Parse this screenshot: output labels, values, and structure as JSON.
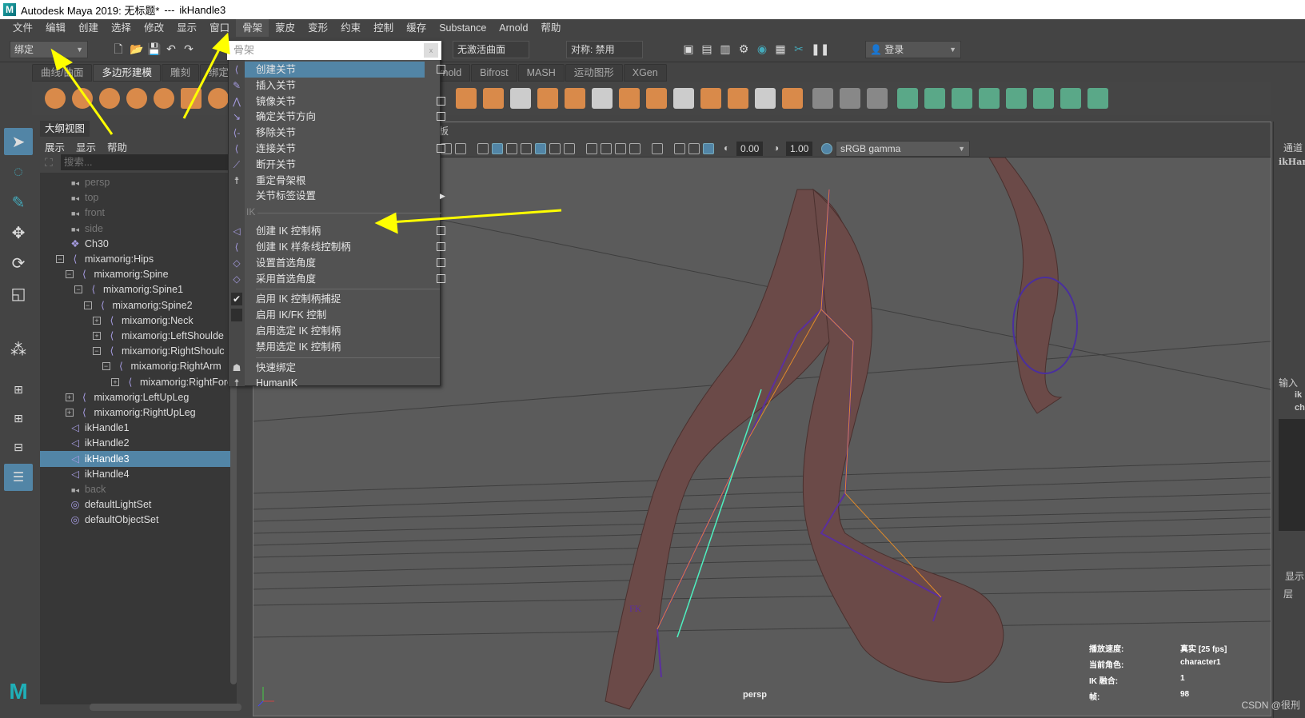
{
  "title": {
    "app": "Autodesk Maya 2019: 无标题*",
    "sep": "---",
    "object": "ikHandle3",
    "logo_letter": "M"
  },
  "menubar": [
    "文件",
    "编辑",
    "创建",
    "选择",
    "修改",
    "显示",
    "窗口",
    "骨架",
    "蒙皮",
    "变形",
    "约束",
    "控制",
    "缓存",
    "Substance",
    "Arnold",
    "帮助"
  ],
  "status": {
    "mode": "绑定",
    "menu_search_placeholder": "骨架",
    "curve": "无激活曲面",
    "symmetry": "对称: 禁用",
    "login": "登录"
  },
  "shelf_tabs": [
    "曲线/曲面",
    "多边形建模",
    "雕刻",
    "绑定",
    "Arnold",
    "Bifrost",
    "MASH",
    "运动图形",
    "XGen"
  ],
  "shelf_active": "多边形建模",
  "outliner": {
    "tab": "大纲视图",
    "menu": [
      "展示",
      "显示",
      "帮助"
    ],
    "search_placeholder": "搜索...",
    "items": [
      {
        "label": "persp",
        "icon": "camera-icon",
        "depth": 0,
        "dim": true
      },
      {
        "label": "top",
        "icon": "camera-icon",
        "depth": 0,
        "dim": true
      },
      {
        "label": "front",
        "icon": "camera-icon",
        "depth": 0,
        "dim": true
      },
      {
        "label": "side",
        "icon": "camera-icon",
        "depth": 0,
        "dim": true
      },
      {
        "label": "Ch30",
        "icon": "mesh-group-icon",
        "depth": 0
      },
      {
        "label": "mixamorig:Hips",
        "icon": "joint-icon",
        "depth": 0,
        "exp": "-"
      },
      {
        "label": "mixamorig:Spine",
        "icon": "joint-icon",
        "depth": 1,
        "exp": "-"
      },
      {
        "label": "mixamorig:Spine1",
        "icon": "joint-icon",
        "depth": 2,
        "exp": "-"
      },
      {
        "label": "mixamorig:Spine2",
        "icon": "joint-icon",
        "depth": 3,
        "exp": "-"
      },
      {
        "label": "mixamorig:Neck",
        "icon": "joint-icon",
        "depth": 4,
        "exp": "+"
      },
      {
        "label": "mixamorig:LeftShoulde",
        "icon": "joint-icon",
        "depth": 4,
        "exp": "+"
      },
      {
        "label": "mixamorig:RightShoulc",
        "icon": "joint-icon",
        "depth": 4,
        "exp": "-"
      },
      {
        "label": "mixamorig:RightArm",
        "icon": "joint-icon",
        "depth": 5,
        "exp": "-"
      },
      {
        "label": "mixamorig:RightFore",
        "icon": "joint-icon",
        "depth": 6,
        "exp": "+"
      },
      {
        "label": "mixamorig:LeftUpLeg",
        "icon": "joint-icon",
        "depth": 1,
        "exp": "+"
      },
      {
        "label": "mixamorig:RightUpLeg",
        "icon": "joint-icon",
        "depth": 1,
        "exp": "+"
      },
      {
        "label": "ikHandle1",
        "icon": "ik-handle-icon",
        "depth": 0
      },
      {
        "label": "ikHandle2",
        "icon": "ik-handle-icon",
        "depth": 0
      },
      {
        "label": "ikHandle3",
        "icon": "ik-handle-icon",
        "depth": 0,
        "selected": true
      },
      {
        "label": "ikHandle4",
        "icon": "ik-handle-icon",
        "depth": 0
      },
      {
        "label": "back",
        "icon": "camera-icon",
        "depth": 0,
        "dim": true
      },
      {
        "label": "defaultLightSet",
        "icon": "set-icon",
        "depth": 0
      },
      {
        "label": "defaultObjectSet",
        "icon": "set-icon",
        "depth": 0
      }
    ]
  },
  "skeleton_menu": {
    "items": [
      {
        "label": "创建关节",
        "icon": "create-joint-icon",
        "option": true,
        "highlight": true
      },
      {
        "label": "插入关节",
        "icon": "insert-joint-icon"
      },
      {
        "label": "镜像关节",
        "icon": "mirror-joint-icon",
        "option": true
      },
      {
        "label": "确定关节方向",
        "icon": "orient-joint-icon",
        "option": true
      },
      {
        "label": "移除关节",
        "icon": "remove-joint-icon"
      },
      {
        "label": "连接关节",
        "icon": "connect-joint-icon",
        "option": true
      },
      {
        "label": "断开关节",
        "icon": "disconnect-joint-icon"
      },
      {
        "label": "重定骨架根",
        "icon": "reroot-skeleton-icon"
      },
      {
        "label": "关节标签设置",
        "icon": "",
        "submenu": true
      }
    ],
    "ik_section": "IK",
    "ik_items": [
      {
        "label": "创建 IK 控制柄",
        "icon": "ik-handle-icon",
        "option": true
      },
      {
        "label": "创建 IK 样条线控制柄",
        "icon": "ik-spline-icon",
        "option": true
      },
      {
        "label": "设置首选角度",
        "icon": "set-preferred-angle-icon",
        "option": true
      },
      {
        "label": "采用首选角度",
        "icon": "assume-preferred-angle-icon",
        "option": true
      }
    ],
    "toggle_items": [
      {
        "label": "启用 IK 控制柄捕捉",
        "checked": true
      },
      {
        "label": "启用 IK/FK 控制",
        "checked": false
      },
      {
        "label": "启用选定 IK 控制柄"
      },
      {
        "label": "禁用选定 IK 控制柄"
      }
    ],
    "rig_items": [
      {
        "label": "快速绑定",
        "icon": "quick-rig-icon"
      },
      {
        "label": "HumanIK",
        "icon": "humanik-icon"
      }
    ]
  },
  "viewport": {
    "panel_menu_fragment": "板",
    "exposure": "0.00",
    "gamma": "1.00",
    "color_space": "sRGB gamma",
    "camera": "persp",
    "fk_label": "FK",
    "hud": [
      {
        "k": "播放速度:",
        "v": "真实 [25 fps]"
      },
      {
        "k": "当前角色:",
        "v": "character1"
      },
      {
        "k": "IK 融合:",
        "v": "1"
      },
      {
        "k": "帧:",
        "v": "98"
      }
    ]
  },
  "right_panel": {
    "channel": "通道",
    "object": "ikHan",
    "inputs": "输入",
    "input1": "ik",
    "input2": "ch",
    "display": "显示",
    "layer": "层"
  },
  "watermark": "CSDN @很刑",
  "colors": {
    "accent": "#5285a6",
    "annotation": "#ffff00",
    "joint": "#a59be0"
  }
}
